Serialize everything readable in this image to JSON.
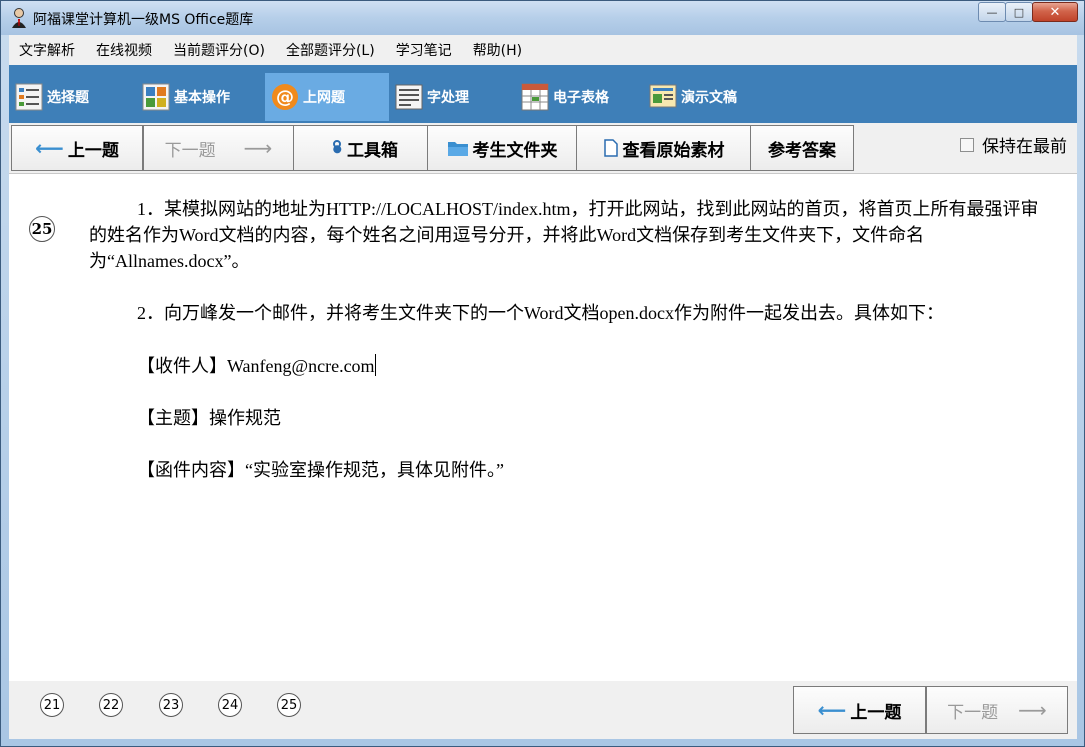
{
  "window": {
    "title": "阿福课堂计算机一级MS Office题库",
    "controls": {
      "minimize": "—",
      "maximize": "□",
      "close": "✕"
    }
  },
  "menu": [
    "文字解析",
    "在线视频",
    "当前题评分(O)",
    "全部题评分(L)",
    "学习笔记",
    "帮助(H)"
  ],
  "modules": [
    {
      "label": "选择题",
      "icon": "list-icon"
    },
    {
      "label": "基本操作",
      "icon": "grid-icon"
    },
    {
      "label": "上网题",
      "icon": "at-icon"
    },
    {
      "label": "字处理",
      "icon": "document-icon"
    },
    {
      "label": "电子表格",
      "icon": "spreadsheet-icon"
    },
    {
      "label": "演示文稿",
      "icon": "presentation-icon"
    }
  ],
  "nav": {
    "prev": "上一题",
    "next": "下一题",
    "toolbox": "工具箱",
    "examinee_folder": "考生文件夹",
    "view_source": "查看原始素材",
    "answer": "参考答案",
    "keep_on_top": "保持在最前"
  },
  "question": {
    "number": "25",
    "para1": "1．某模拟网站的地址为HTTP://LOCALHOST/index.htm，打开此网站，找到此网站的首页，将首页上所有最强评审的姓名作为Word文档的内容，每个姓名之间用逗号分开，并将此Word文档保存到考生文件夹下，文件命名为“Allnames.docx”。",
    "para2": "2．向万峰发一个邮件，并将考生文件夹下的一个Word文档open.docx作为附件一起发出去。具体如下：",
    "recipient": "【收件人】Wanfeng@ncre.com",
    "subject": "【主题】操作规范",
    "body": "【函件内容】“实验室操作规范，具体见附件。”"
  },
  "bottom": {
    "question_numbers": [
      "21",
      "22",
      "23",
      "24",
      "25"
    ],
    "prev": "上一题",
    "next": "下一题"
  },
  "colors": {
    "toolbar_bg": "#3e7fb8",
    "active_module": "#6aabe3"
  }
}
